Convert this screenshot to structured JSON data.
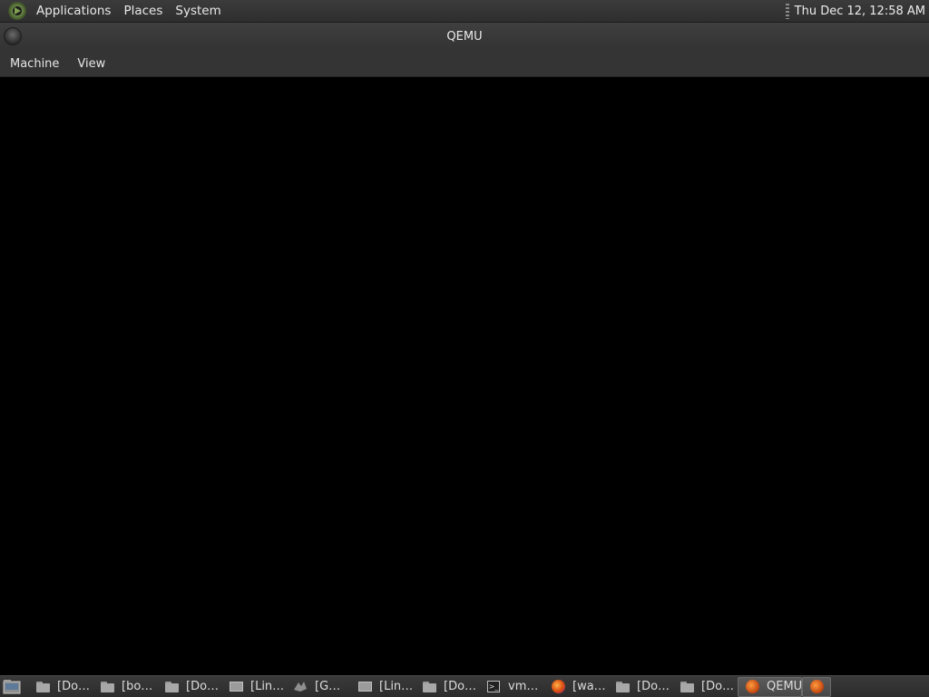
{
  "top_panel": {
    "menus": [
      "Applications",
      "Places",
      "System"
    ],
    "clock": "Thu Dec 12, 12:58 AM"
  },
  "window": {
    "title": "QEMU",
    "menubar": [
      "Machine",
      "View"
    ]
  },
  "taskbar": {
    "tasks": [
      {
        "label": "[Do…",
        "icon": "folder-icon"
      },
      {
        "label": "[bo…",
        "icon": "folder-icon"
      },
      {
        "label": "[Do…",
        "icon": "folder-icon"
      },
      {
        "label": "[Lin…",
        "icon": "monitor-icon"
      },
      {
        "label": "[G…",
        "icon": "gimp-icon"
      },
      {
        "label": "[Lin…",
        "icon": "monitor-icon"
      },
      {
        "label": "[Do…",
        "icon": "folder-icon"
      },
      {
        "label": "vm…",
        "icon": "terminal-icon"
      },
      {
        "label": "[wa…",
        "icon": "firefox-icon"
      },
      {
        "label": "[Do…",
        "icon": "folder-icon"
      },
      {
        "label": "[Do…",
        "icon": "folder-icon"
      },
      {
        "label": "QEMU",
        "icon": "qemu-icon",
        "active": true
      },
      {
        "label": "",
        "icon": "qemu-icon"
      }
    ]
  }
}
